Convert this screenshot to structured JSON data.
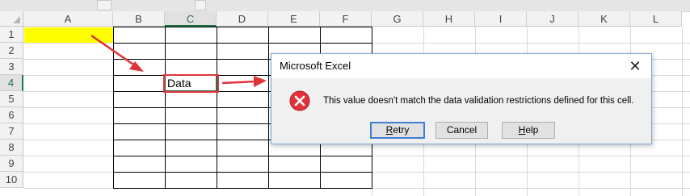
{
  "sheet": {
    "columns": [
      "A",
      "B",
      "C",
      "D",
      "E",
      "F",
      "G",
      "H",
      "I",
      "J",
      "K",
      "L"
    ],
    "rows": [
      "1",
      "2",
      "3",
      "4",
      "5",
      "6",
      "7",
      "8",
      "9",
      "10"
    ],
    "selected_column": "C",
    "selected_row": "4",
    "cells": {
      "C4": "Data"
    },
    "highlight_colors": {
      "fill_A1": "#ffff00",
      "annotation_red": "#e0323a",
      "selection_green": "#217346"
    }
  },
  "dialog": {
    "title": "Microsoft Excel",
    "close_glyph": "✕",
    "icon": "error-icon",
    "message": "This value doesn't match the data validation restrictions defined for this cell.",
    "buttons": {
      "retry": {
        "mnemonic": "R",
        "rest": "etry"
      },
      "cancel": {
        "label": "Cancel"
      },
      "help": {
        "mnemonic": "H",
        "rest": "elp"
      }
    }
  }
}
